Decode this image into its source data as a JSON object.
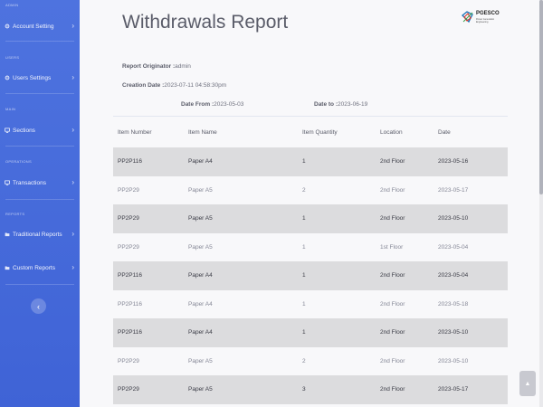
{
  "sidebar": {
    "sections": [
      {
        "title": "ADMIN",
        "items": [
          {
            "label": "Account Setting",
            "icon": "gear-icon"
          }
        ]
      },
      {
        "title": "USERS",
        "items": [
          {
            "label": "Users Settings",
            "icon": "gear-icon"
          }
        ]
      },
      {
        "title": "MAIN",
        "items": [
          {
            "label": "Sections",
            "icon": "monitor-icon"
          }
        ]
      },
      {
        "title": "OPERATIONS",
        "items": [
          {
            "label": "Transactions",
            "icon": "monitor-icon"
          }
        ]
      },
      {
        "title": "REPORTS",
        "items": [
          {
            "label": "Traditional Reports",
            "icon": "folder-icon"
          },
          {
            "label": "Custom Reports",
            "icon": "folder-icon"
          }
        ]
      }
    ],
    "toggle_symbol": "‹"
  },
  "header": {
    "title": "Withdrawals Report",
    "logo_text": "PGESCO",
    "logo_sub": "Power Generation Engineering"
  },
  "report": {
    "originator_label": "Report Originator :",
    "originator_value": "admin",
    "creation_label": "Creation Date :",
    "creation_value": "2023-07-11 04:58:30pm",
    "date_from_label": "Date From :",
    "date_from_value": "2023-05-03",
    "date_to_label": "Date to :",
    "date_to_value": "2023-06-19"
  },
  "table": {
    "columns": [
      "Item Number",
      "Item Name",
      "Item Quantity",
      "Location",
      "Date"
    ],
    "rows": [
      [
        "PP2P116",
        "Paper A4",
        "1",
        "2nd Floor",
        "2023-05-16"
      ],
      [
        "PP2P29",
        "Paper A5",
        "2",
        "2nd Floor",
        "2023-05-17"
      ],
      [
        "PP2P29",
        "Paper A5",
        "1",
        "2nd Floor",
        "2023-05-10"
      ],
      [
        "PP2P29",
        "Paper A5",
        "1",
        "1st Floor",
        "2023-05-04"
      ],
      [
        "PP2P116",
        "Paper A4",
        "1",
        "2nd Floor",
        "2023-05-04"
      ],
      [
        "PP2P116",
        "Paper A4",
        "1",
        "2nd Floor",
        "2023-05-18"
      ],
      [
        "PP2P116",
        "Paper A4",
        "1",
        "2nd Floor",
        "2023-05-10"
      ],
      [
        "PP2P29",
        "Paper A5",
        "2",
        "2nd Floor",
        "2023-05-10"
      ],
      [
        "PP2P29",
        "Paper A5",
        "3",
        "2nd Floor",
        "2023-05-17"
      ]
    ]
  },
  "scroll_top_symbol": "▲",
  "colors": {
    "sidebar": "#4e73df",
    "row_shade": "#dcdcde",
    "text": "#5a5c69"
  }
}
